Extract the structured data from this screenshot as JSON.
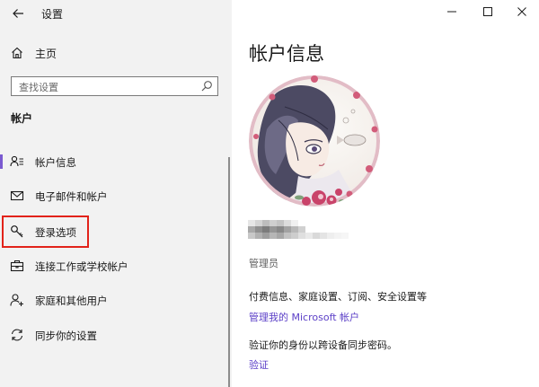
{
  "app": {
    "title": "设置"
  },
  "sidebar": {
    "home_label": "主页",
    "search_placeholder": "查找设置",
    "section_title": "帐户",
    "items": [
      {
        "label": "帐户信息",
        "icon": "account-info-icon",
        "selected": true
      },
      {
        "label": "电子邮件和帐户",
        "icon": "mail-icon"
      },
      {
        "label": "登录选项",
        "icon": "key-icon",
        "highlighted": true
      },
      {
        "label": "连接工作或学校帐户",
        "icon": "briefcase-icon"
      },
      {
        "label": "家庭和其他用户",
        "icon": "add-person-icon"
      },
      {
        "label": "同步你的设置",
        "icon": "sync-icon"
      }
    ]
  },
  "main": {
    "page_title": "帐户信息",
    "role": "管理员",
    "billing_text": "付费信息、家庭设置、订阅、安全设置等",
    "manage_link": "管理我的 Microsoft 帐户",
    "verify_text": "验证你的身份以跨设备同步密码。",
    "verify_link": "验证"
  },
  "colors": {
    "sidebar_bg": "#f2f2f2",
    "accent": "#7a5ad0",
    "link": "#5b3fc7",
    "highlight_border": "#e2231a"
  }
}
